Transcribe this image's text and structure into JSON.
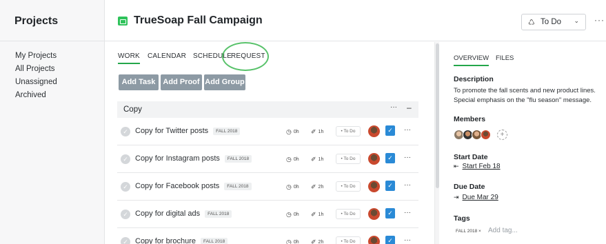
{
  "sidebar": {
    "title": "Projects",
    "items": [
      "My Projects",
      "All Projects",
      "Unassigned",
      "Archived"
    ]
  },
  "header": {
    "project_title": "TrueSoap Fall Campaign",
    "status": "To Do",
    "more": "···"
  },
  "tabs": [
    "WORK",
    "CALENDAR",
    "SCHEDULE",
    "REQUEST"
  ],
  "active_tab": "WORK",
  "buttons": {
    "add_task": "Add Task",
    "add_proof": "Add Proof",
    "add_group": "Add Group"
  },
  "group": {
    "name": "Copy",
    "dots": "···",
    "collapse": "–"
  },
  "tasks": [
    {
      "name": "Copy for Twitter posts",
      "tag": "FALL 2018",
      "time": "0h",
      "estimate": "1h",
      "status": "To Do"
    },
    {
      "name": "Copy for Instagram posts",
      "tag": "FALL 2018",
      "time": "0h",
      "estimate": "1h",
      "status": "To Do"
    },
    {
      "name": "Copy for Facebook posts",
      "tag": "FALL 2018",
      "time": "0h",
      "estimate": "2h",
      "status": "To Do"
    },
    {
      "name": "Copy for digital ads",
      "tag": "FALL 2018",
      "time": "0h",
      "estimate": "1h",
      "status": "To Do"
    },
    {
      "name": "Copy for brochure",
      "tag": "FALL 2018",
      "time": "0h",
      "estimate": "2h",
      "status": "To Do"
    }
  ],
  "panel": {
    "tabs": [
      "OVERVIEW",
      "FILES"
    ],
    "description_label": "Description",
    "description": "To promote the fall scents and new product lines. Special emphasis on the \"flu season\" message.",
    "members_label": "Members",
    "start_label": "Start Date",
    "start_value": "Start Feb 18",
    "due_label": "Due Date",
    "due_value": "Due Mar 29",
    "tags_label": "Tags",
    "tag_chip": "FALL 2018 ×",
    "tag_placeholder": "Add tag..."
  },
  "colors": {
    "accent": "#23a64a",
    "button": "#8d9aa4",
    "status_blue": "#2a8ad6",
    "annotation_circle": "#58c26a"
  }
}
